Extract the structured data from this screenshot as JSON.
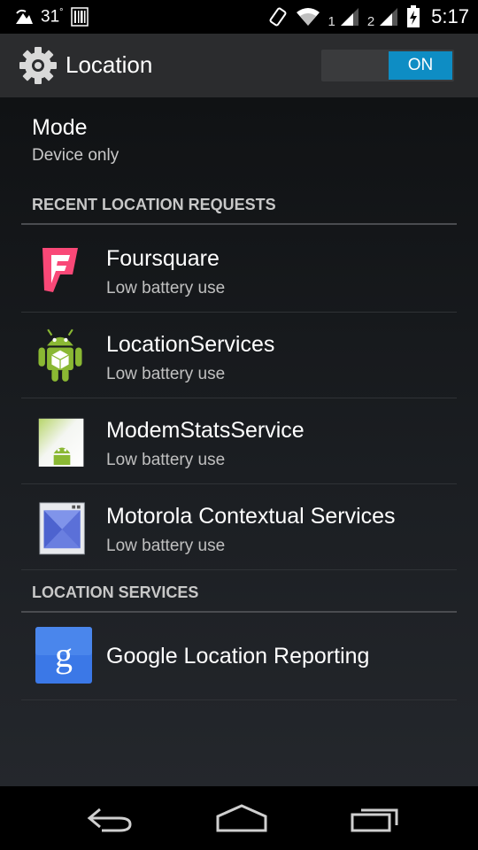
{
  "status_bar": {
    "temperature": "31",
    "degree": "°",
    "sim1": "1",
    "sim2": "2",
    "time": "5:17",
    "icons": [
      "weather-icon",
      "barcode-icon",
      "vibrate-icon",
      "wifi-icon",
      "signal-sim1-icon",
      "signal-sim2-icon",
      "battery-charging-icon"
    ]
  },
  "action_bar": {
    "title": "Location",
    "toggle_label": "ON",
    "accent": "#0e8dc4"
  },
  "mode": {
    "title": "Mode",
    "value": "Device only"
  },
  "recent_requests": {
    "header": "RECENT LOCATION REQUESTS",
    "items": [
      {
        "title": "Foursquare",
        "subtitle": "Low battery use",
        "icon": "foursquare-icon"
      },
      {
        "title": "LocationServices",
        "subtitle": "Low battery use",
        "icon": "android-robot-icon"
      },
      {
        "title": "ModemStatsService",
        "subtitle": "Low battery use",
        "icon": "android-app-icon"
      },
      {
        "title": "Motorola Contextual Services",
        "subtitle": "Low battery use",
        "icon": "motorola-contextual-icon"
      }
    ]
  },
  "location_services": {
    "header": "LOCATION SERVICES",
    "items": [
      {
        "title": "Google Location Reporting",
        "icon": "google-settings-icon"
      }
    ]
  },
  "nav_bar": {
    "buttons": [
      "back-icon",
      "home-icon",
      "recents-icon"
    ]
  }
}
